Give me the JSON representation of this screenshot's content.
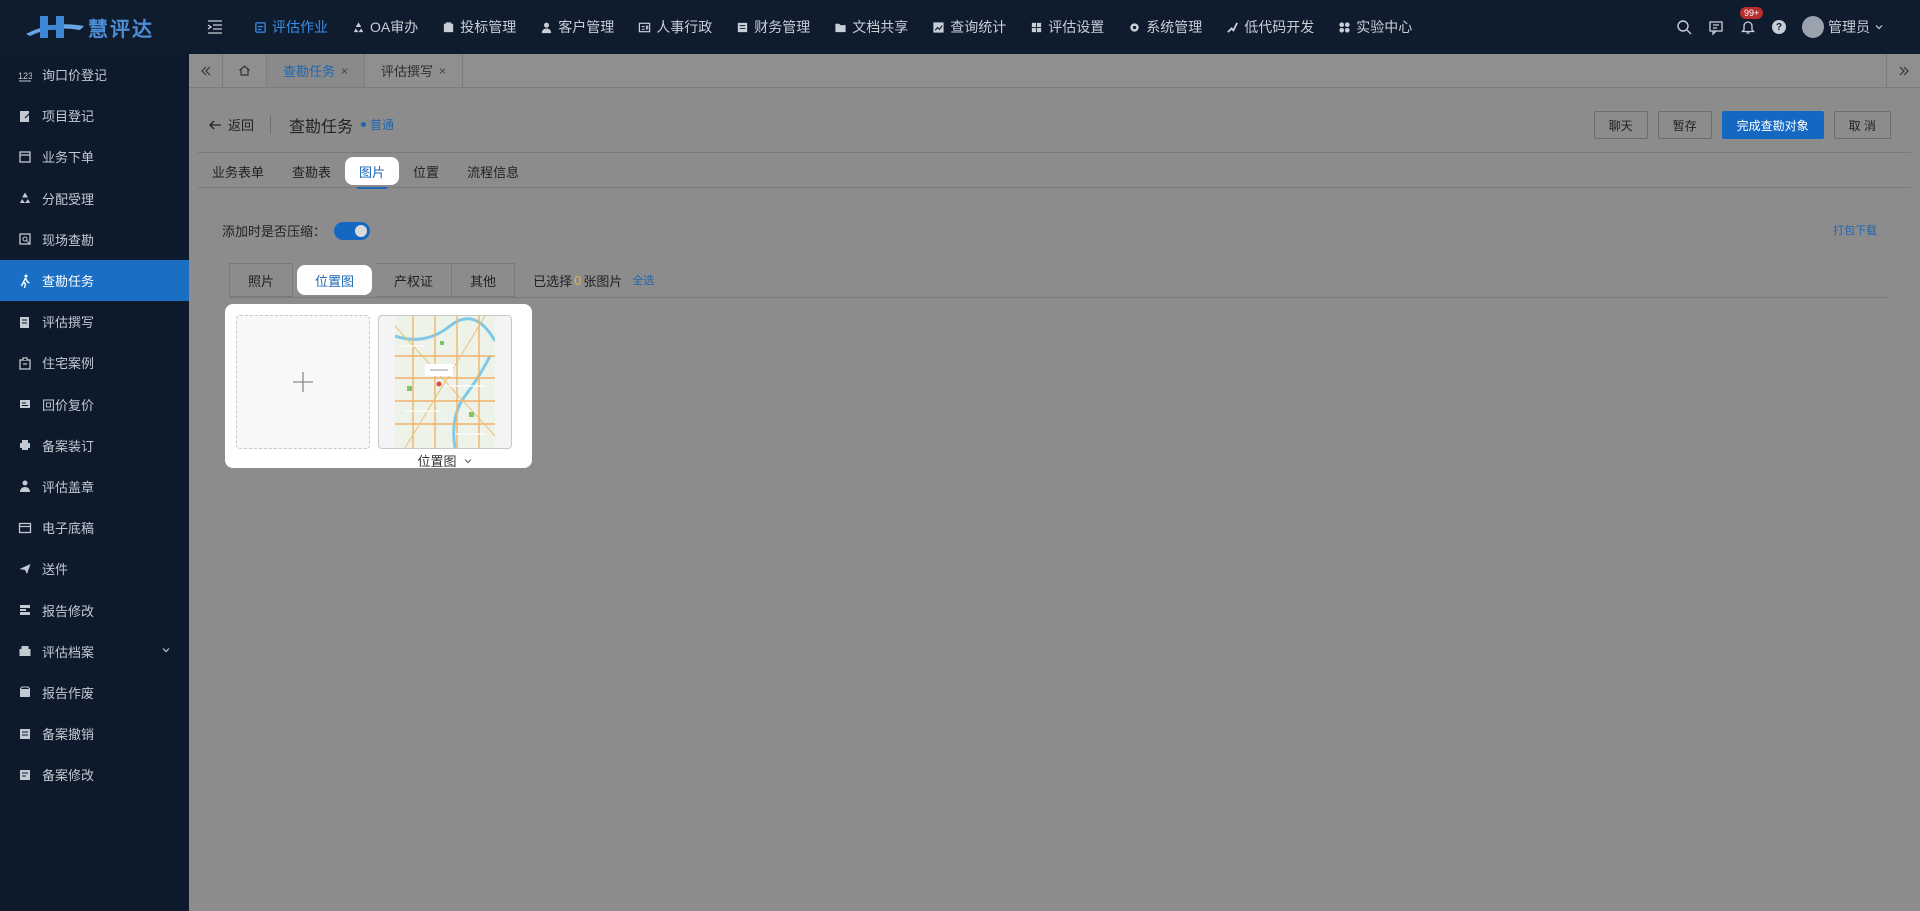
{
  "app": {
    "logo_text": "慧评达"
  },
  "topnav": [
    {
      "label": "评估作业",
      "icon": "task-icon",
      "active": true
    },
    {
      "label": "OA审办",
      "icon": "recycle-icon"
    },
    {
      "label": "投标管理",
      "icon": "bid-icon"
    },
    {
      "label": "客户管理",
      "icon": "customer-icon"
    },
    {
      "label": "人事行政",
      "icon": "id-card-icon"
    },
    {
      "label": "财务管理",
      "icon": "finance-icon"
    },
    {
      "label": "文档共享",
      "icon": "folder-icon"
    },
    {
      "label": "查询统计",
      "icon": "chart-icon"
    },
    {
      "label": "评估设置",
      "icon": "settings-grid-icon"
    },
    {
      "label": "系统管理",
      "icon": "gear-icon"
    },
    {
      "label": "低代码开发",
      "icon": "code-icon"
    },
    {
      "label": "实验中心",
      "icon": "lab-icon"
    }
  ],
  "topright": {
    "badge": "99+",
    "user": "管理员",
    "help": "?"
  },
  "sidebar": [
    {
      "label": "询口价登记",
      "icon": "number-icon"
    },
    {
      "label": "项目登记",
      "icon": "edit-doc-icon"
    },
    {
      "label": "业务下单",
      "icon": "order-icon"
    },
    {
      "label": "分配受理",
      "icon": "distribute-icon"
    },
    {
      "label": "现场查勘",
      "icon": "survey-icon"
    },
    {
      "label": "查勘任务",
      "icon": "walk-icon",
      "active": true
    },
    {
      "label": "评估撰写",
      "icon": "write-icon"
    },
    {
      "label": "住宅案例",
      "icon": "house-icon"
    },
    {
      "label": "回价复价",
      "icon": "reprice-icon"
    },
    {
      "label": "备案装订",
      "icon": "printer-icon"
    },
    {
      "label": "评估盖章",
      "icon": "stamp-icon"
    },
    {
      "label": "电子底稿",
      "icon": "draft-icon"
    },
    {
      "label": "送件",
      "icon": "send-icon"
    },
    {
      "label": "报告修改",
      "icon": "report-edit-icon"
    },
    {
      "label": "评估档案",
      "icon": "archive-icon",
      "expandable": true
    },
    {
      "label": "报告作废",
      "icon": "box-icon"
    },
    {
      "label": "备案撤销",
      "icon": "revoke-icon"
    },
    {
      "label": "备案修改",
      "icon": "record-edit-icon"
    }
  ],
  "page_tabs": [
    {
      "label": "查勘任务",
      "active": true,
      "close": "×"
    },
    {
      "label": "评估撰写",
      "active": false,
      "close": "×"
    }
  ],
  "header": {
    "back": "返回",
    "title": "查勘任务",
    "level": "普通",
    "buttons": {
      "chat": "聊天",
      "save_draft": "暂存",
      "complete": "完成查勘对象",
      "cancel": "取 消"
    }
  },
  "subtabs": [
    {
      "label": "业务表单"
    },
    {
      "label": "查勘表"
    },
    {
      "label": "图片",
      "active": true
    },
    {
      "label": "位置"
    },
    {
      "label": "流程信息"
    }
  ],
  "compress": {
    "label": "添加时是否压缩：",
    "enabled": true
  },
  "pack_download": "打包下载",
  "image_tabs": [
    {
      "label": "照片"
    },
    {
      "label": "位置图",
      "active": true
    },
    {
      "label": "产权证"
    },
    {
      "label": "其他"
    }
  ],
  "selection": {
    "prefix": "已选择",
    "count": "0",
    "suffix": "张图片",
    "select_all": "全选"
  },
  "thumbnail": {
    "caption": "位置图"
  },
  "colors": {
    "accent": "#1468c2",
    "topbar": "#0f1c2e",
    "sidebar": "#0d1a2b",
    "overlay_bg": "#8c8c8c"
  }
}
